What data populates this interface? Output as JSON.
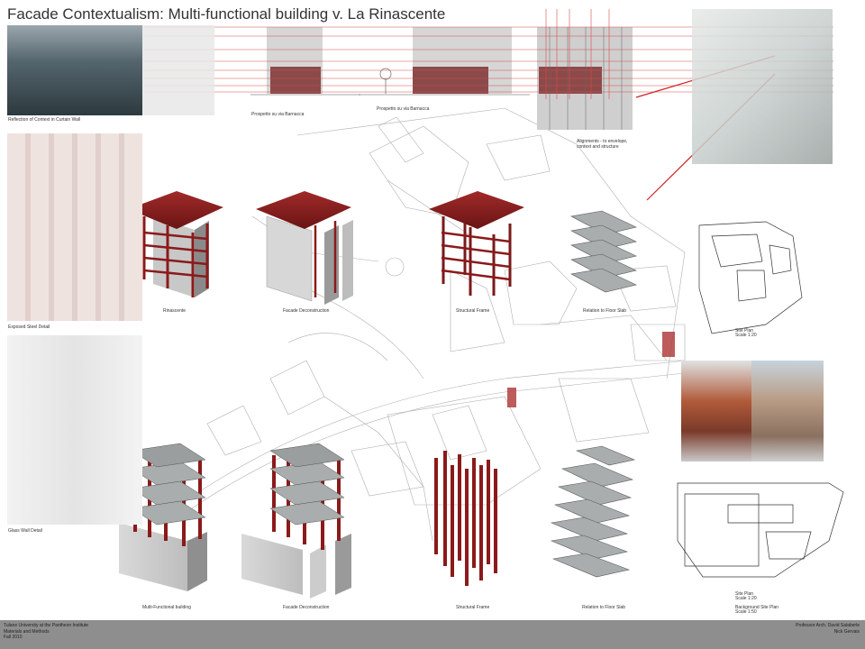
{
  "title": "Facade Contextualism: Multi-functional building v. La Rinascente",
  "captions": {
    "reflection": "Reflection of Context in Curtain Wall",
    "exposed_steel": "Exposed Steel Detail",
    "glass_wall": "Glass Wall Detail",
    "alignments_1": "Alignments - to envelope,",
    "alignments_2": "context and structure",
    "prospect_1": "Prospetto su via Barnacca",
    "prospect_2": "Prospetto su via Barnacca",
    "rinascente": "Rinascente",
    "facade_decon_top": "Facade Deconstruction",
    "structural_frame_top": "Structural Frame",
    "floor_slab_top": "Relation to Floor Slab",
    "multi_functional": "Multi-Functional building",
    "facade_decon_bottom": "Facade Deconstruction",
    "structural_frame_bottom": "Structural Frame",
    "floor_slab_bottom": "Relation to Floor Slab",
    "site_plan_top": "Site Plan",
    "scale_top": "Scale 1:20",
    "site_plan_bottom": "Site Plan",
    "scale_bottom": "Scale 1:20",
    "background_site_plan": "Background Site Plan",
    "scale_background": "Scale 1:50"
  },
  "footer": {
    "left_1": "Tulane University at the Pantheon Institute",
    "left_2": "Materials and Methods",
    "left_3": "Fall 2010",
    "right_1": "Professor Arch. David Salaberle",
    "right_2": "Nick Gervais"
  },
  "colors": {
    "accent_red": "#8b1a1a",
    "alignment_line": "#d94a4a",
    "footer_bg": "#8e8e8e",
    "slab_gray": "#a9adad"
  }
}
